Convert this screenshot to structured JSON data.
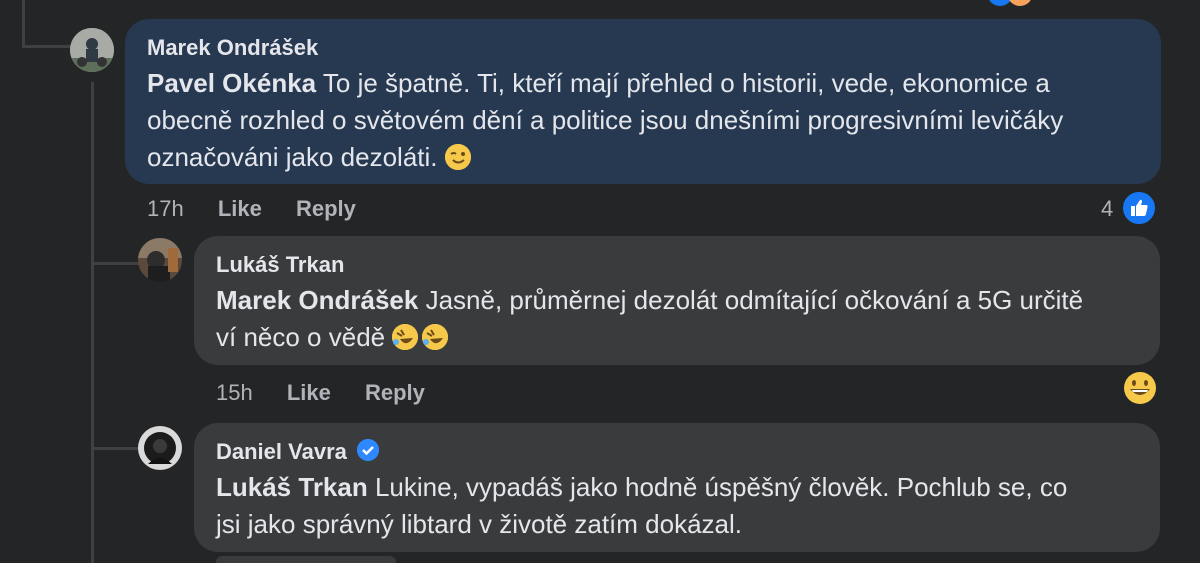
{
  "comments": [
    {
      "author": "Marek Ondrášek",
      "mention": "Pavel Okénka",
      "text_line1": "To je špatně. Ti, kteří mají přehled o historii, vede, ekonomice a",
      "text_line2": "obecně rozhled o světovém dění a politice jsou dnešními progresivními levičáky",
      "text_line3": "označováni jako dezoláti.",
      "emoji": "winking-face",
      "time": "17h",
      "like_label": "Like",
      "reply_label": "Reply",
      "reaction_count": "4",
      "reaction_icon": "like-icon"
    },
    {
      "author": "Lukáš Trkan",
      "mention": "Marek Ondrášek",
      "text_line1": "Jasně, průměrnej dezolát odmítající očkování a 5G určitě",
      "text_line2": "ví něco o vědě",
      "emojis": [
        "rolling-on-floor-laughing",
        "rolling-on-floor-laughing"
      ],
      "time": "15h",
      "like_label": "Like",
      "reply_label": "Reply",
      "reaction_icon": "grinning-face-icon"
    },
    {
      "author": "Daniel Vavra",
      "verified": true,
      "mention": "Lukáš Trkan",
      "text_line1": "Lukine, vypadáš jako hodně úspěšný člověk. Pochlub se, co",
      "text_line2": "jsi jako správný libtard v životě zatím dokázal."
    }
  ],
  "colors": {
    "background": "#242526",
    "highlight_bubble": "#263951",
    "bubble": "#3a3b3c",
    "like_blue": "#1877f2",
    "verified_blue": "#2e89ff"
  }
}
